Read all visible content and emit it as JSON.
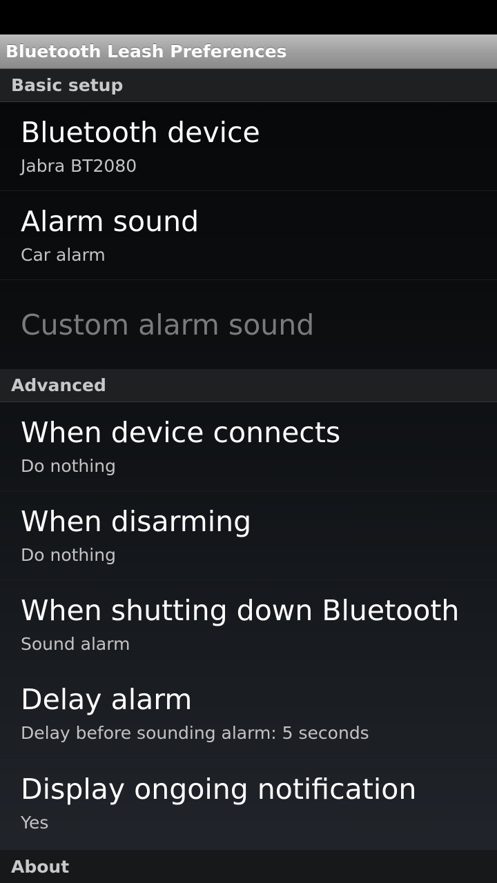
{
  "app": {
    "title": "Bluetooth Leash Preferences"
  },
  "sections": {
    "basic": {
      "label": "Basic setup",
      "items": [
        {
          "title": "Bluetooth device",
          "summary": "Jabra BT2080"
        },
        {
          "title": "Alarm sound",
          "summary": "Car alarm"
        },
        {
          "title": "Custom alarm sound",
          "disabled": true
        }
      ]
    },
    "advanced": {
      "label": "Advanced",
      "items": [
        {
          "title": "When device connects",
          "summary": "Do nothing"
        },
        {
          "title": "When disarming",
          "summary": "Do nothing"
        },
        {
          "title": "When shutting down Bluetooth",
          "summary": "Sound alarm"
        },
        {
          "title": "Delay alarm",
          "summary": "Delay before sounding alarm: 5 seconds"
        },
        {
          "title": "Display ongoing notification",
          "summary": "Yes"
        }
      ]
    },
    "about": {
      "label": "About"
    }
  },
  "colors": {
    "title_bar": "#9d9d9d",
    "category_bg": "#1f2021",
    "text_primary": "#ffffff",
    "text_secondary": "#c3c3c3",
    "text_disabled": "#7b7b7b"
  }
}
